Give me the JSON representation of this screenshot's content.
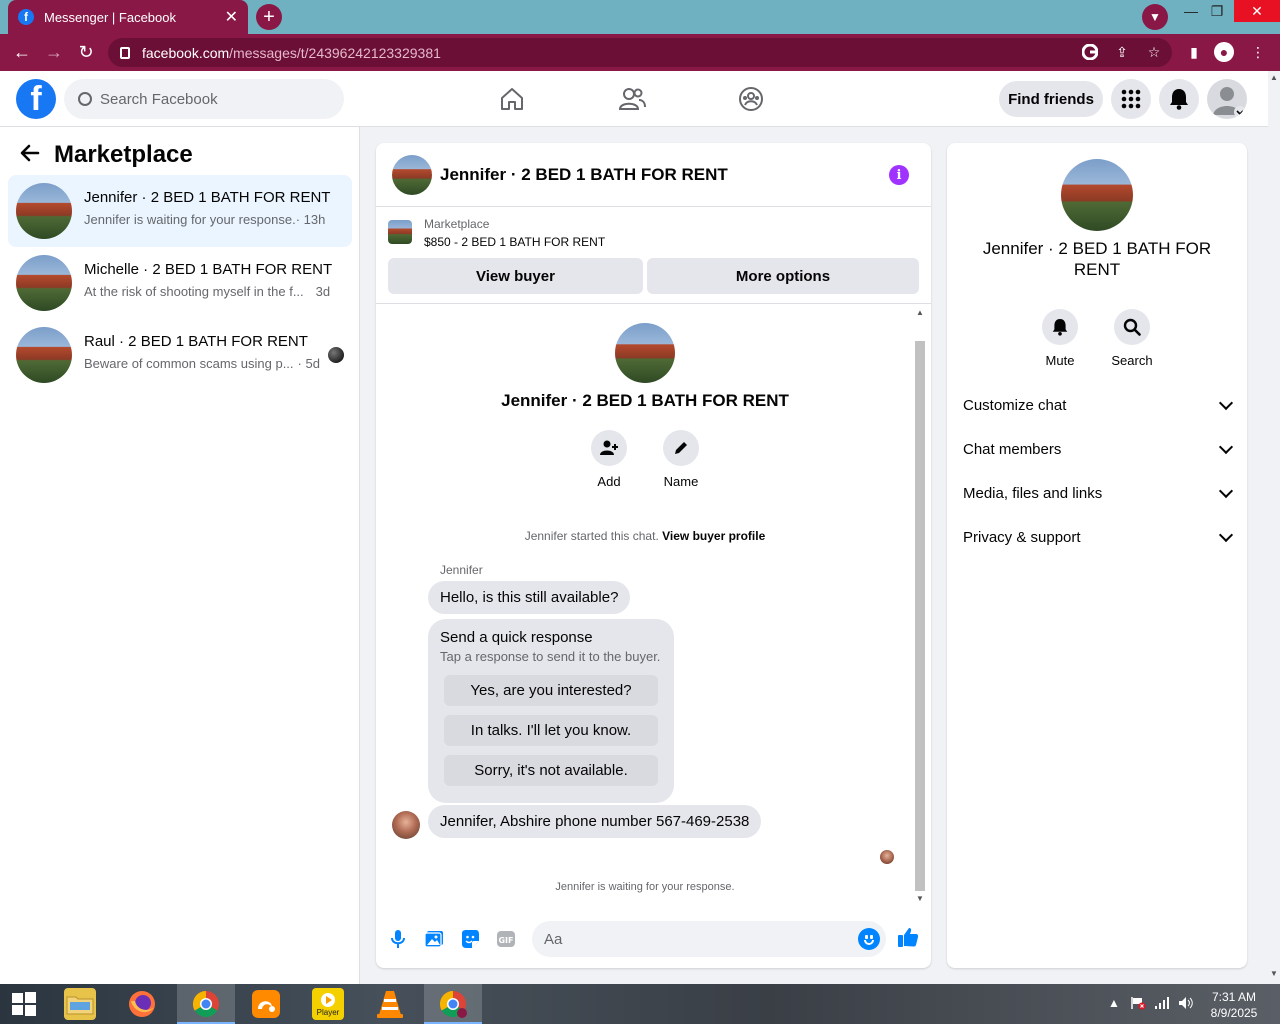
{
  "browser": {
    "tab_title": "Messenger | Facebook",
    "url_host": "facebook.com",
    "url_path": "/messages/t/24396242123329381"
  },
  "header": {
    "search_placeholder": "Search Facebook",
    "find_friends": "Find friends"
  },
  "sidebar": {
    "title": "Marketplace",
    "conversations": [
      {
        "name": "Jennifer · 2 BED 1 BATH FOR RENT",
        "snippet": "Jennifer is waiting for your response.",
        "time": "· 13h"
      },
      {
        "name": "Michelle · 2 BED 1 BATH FOR RENT",
        "snippet": "At the risk of shooting myself in the f...",
        "time": "3d"
      },
      {
        "name": "Raul · 2 BED 1 BATH FOR RENT",
        "snippet": "Beware of common scams using p...",
        "time": "· 5d"
      }
    ]
  },
  "chat": {
    "title": "Jennifer · 2 BED 1 BATH FOR RENT",
    "marketplace_label": "Marketplace",
    "listing": "$850 - 2 BED 1 BATH FOR RENT",
    "view_buyer": "View buyer",
    "more_options": "More options",
    "profile_title": "Jennifer · 2 BED 1 BATH FOR RENT",
    "add_label": "Add",
    "name_label": "Name",
    "started_text": "Jennifer started this chat.",
    "view_buyer_profile": "View buyer profile",
    "sender": "Jennifer",
    "message1": "Hello, is this still available?",
    "quick_title": "Send a quick response",
    "quick_subtitle": "Tap a response to send it to the buyer.",
    "quick_responses": [
      "Yes, are you interested?",
      "In talks. I'll let you know.",
      "Sorry, it's not available."
    ],
    "message2": "Jennifer, Abshire phone number 567-469-2538",
    "waiting_text": "Jennifer is waiting for your response.",
    "composer_placeholder": "Aa"
  },
  "rpanel": {
    "title": "Jennifer · 2 BED 1 BATH FOR RENT",
    "mute": "Mute",
    "search": "Search",
    "sections": [
      "Customize chat",
      "Chat members",
      "Media, files and links",
      "Privacy & support"
    ]
  },
  "taskbar": {
    "time": "7:31 AM",
    "date": "8/9/2025",
    "player_label": "Player"
  },
  "colors": {
    "browser_frame": "#8a1847",
    "fb_blue": "#1877f2",
    "messenger_blue": "#0084ff",
    "info_purple": "#a033ff"
  }
}
